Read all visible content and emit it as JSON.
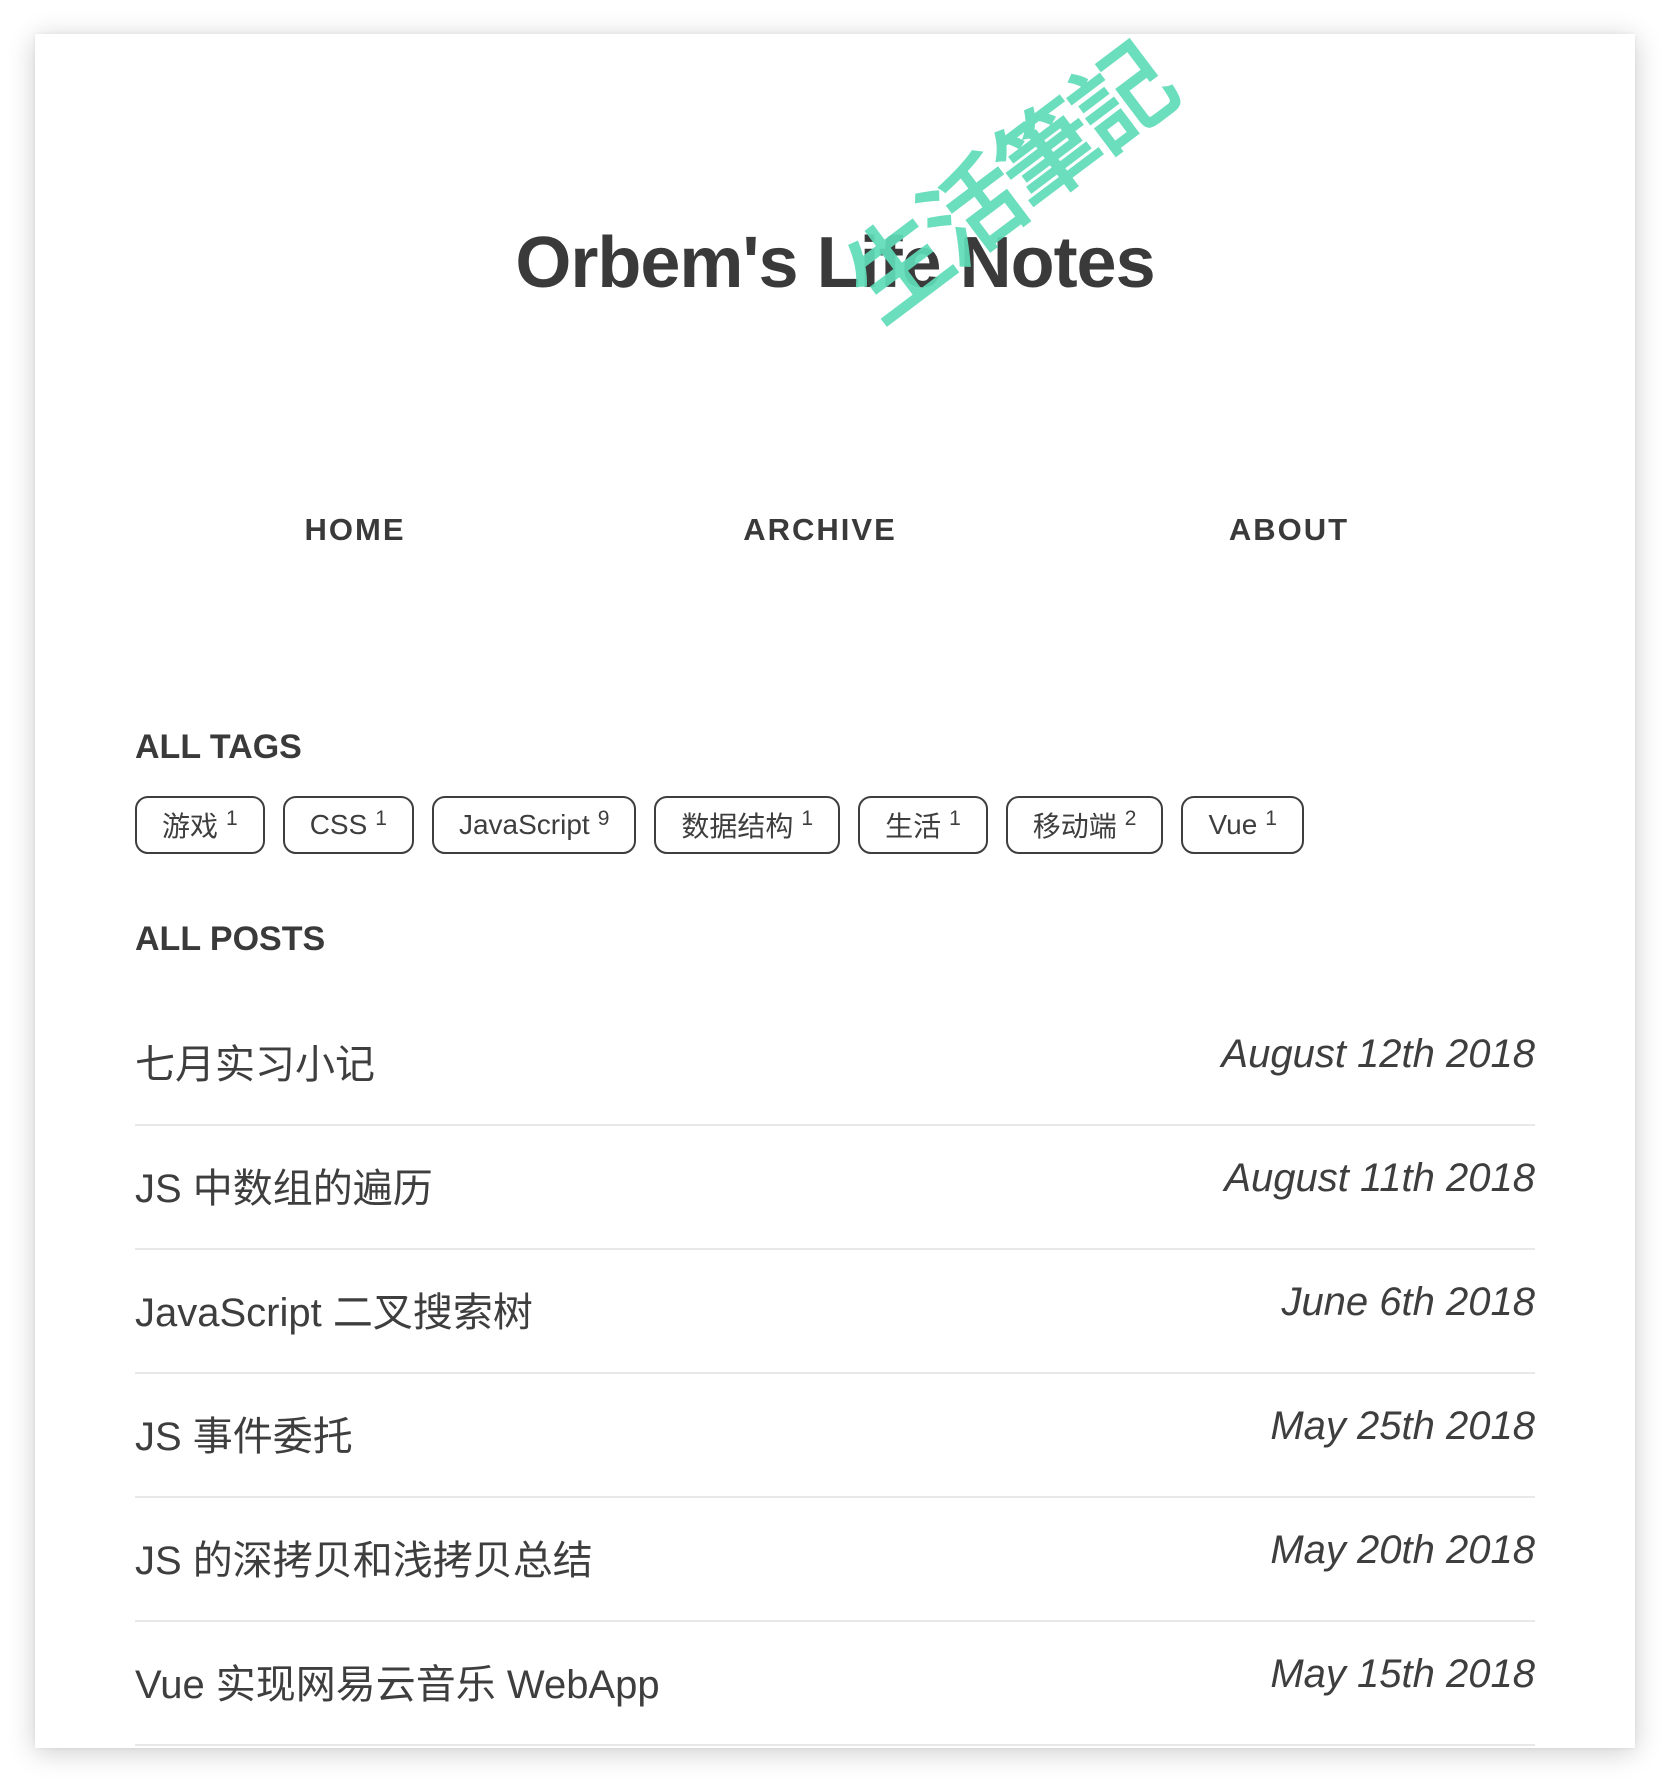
{
  "site": {
    "title": "Orbem's Life Notes",
    "stamp": "生活筆記",
    "stamp_color": "#5fdcb8"
  },
  "nav": {
    "items": [
      {
        "label": "HOME"
      },
      {
        "label": "ARCHIVE"
      },
      {
        "label": "ABOUT"
      }
    ]
  },
  "tags_section": {
    "heading": "ALL TAGS",
    "tags": [
      {
        "name": "游戏",
        "count": "1"
      },
      {
        "name": "CSS",
        "count": "1"
      },
      {
        "name": "JavaScript",
        "count": "9"
      },
      {
        "name": "数据结构",
        "count": "1"
      },
      {
        "name": "生活",
        "count": "1"
      },
      {
        "name": "移动端",
        "count": "2"
      },
      {
        "name": "Vue",
        "count": "1"
      }
    ]
  },
  "posts_section": {
    "heading": "ALL POSTS",
    "posts": [
      {
        "title": "七月实习小记",
        "date": "August 12th 2018"
      },
      {
        "title": "JS 中数组的遍历",
        "date": "August 11th 2018"
      },
      {
        "title": "JavaScript 二叉搜索树",
        "date": "June 6th 2018"
      },
      {
        "title": "JS 事件委托",
        "date": "May 25th 2018"
      },
      {
        "title": "JS 的深拷贝和浅拷贝总结",
        "date": "May 20th 2018"
      },
      {
        "title": "Vue 实现网易云音乐 WebApp",
        "date": "May 15th 2018"
      }
    ]
  }
}
